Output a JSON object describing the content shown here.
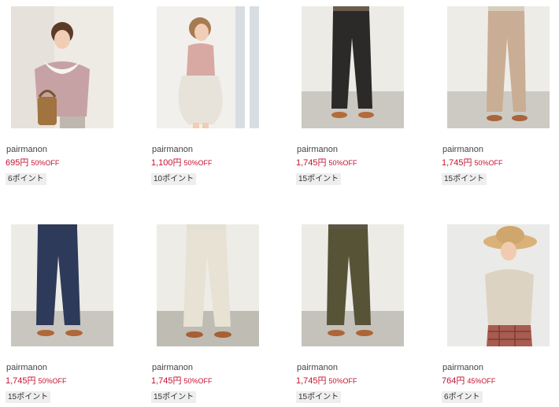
{
  "products": [
    {
      "brand": "pairmanon",
      "price": "695円",
      "discount": "50%OFF",
      "points": "6ポイント",
      "image": "girl-basket-pink-blouse"
    },
    {
      "brand": "pairmanon",
      "price": "1,100円",
      "discount": "50%OFF",
      "points": "10ポイント",
      "image": "girl-pink-dress"
    },
    {
      "brand": "pairmanon",
      "price": "1,745円",
      "discount": "50%OFF",
      "points": "15ポイント",
      "image": "black-pants"
    },
    {
      "brand": "pairmanon",
      "price": "1,745円",
      "discount": "50%OFF",
      "points": "15ポイント",
      "image": "beige-pants"
    },
    {
      "brand": "pairmanon",
      "price": "1,745円",
      "discount": "50%OFF",
      "points": "15ポイント",
      "image": "navy-pants"
    },
    {
      "brand": "pairmanon",
      "price": "1,745円",
      "discount": "50%OFF",
      "points": "15ポイント",
      "image": "ivory-pants"
    },
    {
      "brand": "pairmanon",
      "price": "1,745円",
      "discount": "50%OFF",
      "points": "15ポイント",
      "image": "khaki-pants"
    },
    {
      "brand": "pairmanon",
      "price": "764円",
      "discount": "45%OFF",
      "points": "6ポイント",
      "image": "girl-straw-hat-top"
    }
  ],
  "colors": {
    "price": "#c4112f",
    "brand_text": "#444444",
    "points_bg": "#eeeeee"
  }
}
